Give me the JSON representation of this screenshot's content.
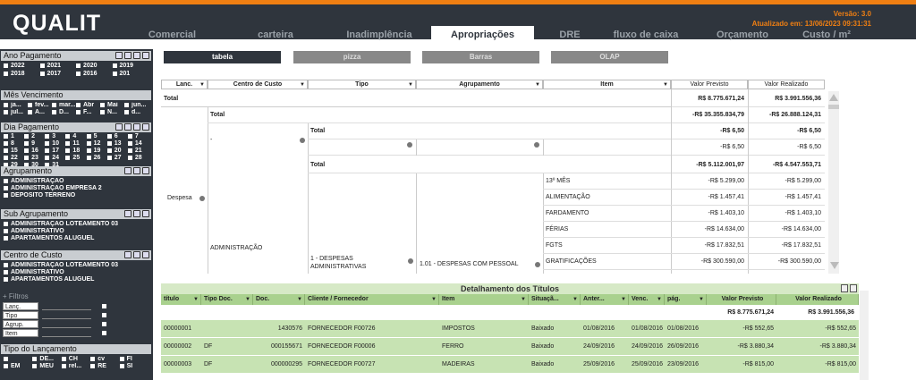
{
  "app": {
    "logo": "QUALIT",
    "version": "Versão: 3.0",
    "updated": "Atualizado em: 13/06/2023 09:31:31"
  },
  "tabs": [
    "Comercial",
    "carteira",
    "Inadimplência",
    "Apropriações",
    "DRE",
    "fluxo de caixa",
    "Orçamento",
    "Custo / m²"
  ],
  "active_tab": "Apropriações",
  "sidebar": {
    "ano": {
      "title": "Ano Pagamento",
      "items": [
        "2022",
        "2021",
        "2020",
        "2019",
        "2018",
        "2017",
        "2016",
        "201"
      ]
    },
    "mes": {
      "title": "Mês Vencimento",
      "items": [
        "ja...",
        "fev...",
        "mar...",
        "Abr",
        "Mai",
        "jun...",
        "jul...",
        "A...",
        "D...",
        "F...",
        "N...",
        "d..."
      ]
    },
    "dia": {
      "title": "Dia Pagamento",
      "items": [
        "1",
        "2",
        "3",
        "4",
        "5",
        "6",
        "7",
        "8",
        "9",
        "10",
        "11",
        "12",
        "13",
        "14",
        "15",
        "16",
        "17",
        "18",
        "19",
        "20",
        "21",
        "22",
        "23",
        "24",
        "25",
        "26",
        "27",
        "28",
        "29",
        "30",
        "31"
      ]
    },
    "agrupamento": {
      "title": "Agrupamento",
      "items": [
        "ADMINISTRAÇÃO",
        "ADMINISTRAÇÃO EMPRESA 2",
        "DEPÓSITO TERRENO"
      ]
    },
    "subagrupamento": {
      "title": "Sub Agrupamento",
      "items": [
        "ADMINISTRAÇÃO LOTEAMENTO 03",
        "ADMINISTRATIVO",
        "APARTAMENTOS ALUGUEL"
      ]
    },
    "centro": {
      "title": "Centro de Custo",
      "items": [
        "ADMINISTRAÇÃO LOTEAMENTO 03",
        "ADMINISTRATIVO",
        "APARTAMENTOS ALUGUEL"
      ]
    },
    "filtros": {
      "title": "+ Filtros",
      "rows": [
        "Lanç.",
        "Tipo",
        "Agrup.",
        "Item"
      ]
    },
    "tipo_lanc": {
      "title": "Tipo do Lançamento",
      "items": [
        "",
        "DE...",
        "CH",
        "cv",
        "FI",
        "EM",
        "MEU",
        "rel...",
        "RE",
        "SI"
      ]
    }
  },
  "views": [
    "tabela",
    "pizza",
    "Barras",
    "OLAP"
  ],
  "main_table": {
    "headers": [
      "Lanc.",
      "Centro de Custo",
      "Tipo",
      "Agrupamento",
      "Item",
      "Valor Previsto",
      "Valor Realizado"
    ],
    "total_label": "Total",
    "total_prev": "R$ 8.775.671,24",
    "total_real": "R$ 3.991.556,36",
    "despesa_label": "Despesa",
    "cc_total_prev": "-R$ 35.355.834,79",
    "cc_total_real": "-R$ 26.888.124,31",
    "dash": "-",
    "dash_total_prev": "-R$ 6,50",
    "dash_total_real": "-R$ 6,50",
    "dash_row_prev": "-R$ 6,50",
    "dash_row_real": "-R$ 6,50",
    "adm_label": "ADMINISTRAÇÃO",
    "adm_total_prev": "-R$ 5.112.001,97",
    "adm_total_real": "-R$ 4.547.553,71",
    "tipo_label": "1 - DESPESAS ADMINISTRATIVAS",
    "agrup_label": "1.01 - DESPESAS COM PESSOAL",
    "items": [
      {
        "name": "13º MÊS",
        "prev": "-R$ 5.299,00",
        "real": "-R$ 5.299,00"
      },
      {
        "name": "ALIMENTAÇÃO",
        "prev": "-R$ 1.457,41",
        "real": "-R$ 1.457,41"
      },
      {
        "name": "FARDAMENTO",
        "prev": "-R$ 1.403,10",
        "real": "-R$ 1.403,10"
      },
      {
        "name": "FÉRIAS",
        "prev": "-R$ 14.634,00",
        "real": "-R$ 14.634,00"
      },
      {
        "name": "FGTS",
        "prev": "-R$ 17.832,51",
        "real": "-R$ 17.832,51"
      },
      {
        "name": "GRATIFICAÇÕES",
        "prev": "-R$ 300.590,00",
        "real": "-R$ 300.590,00"
      }
    ]
  },
  "detail": {
    "title": "Detalhamento dos Títulos",
    "headers": [
      "título",
      "Tipo Doc.",
      "Doc.",
      "Cliente / Fornecedor",
      "Item",
      "Situaçã...",
      "Anter...",
      "Venc.",
      "pág.",
      "Valor Previsto",
      "Valor Realizado"
    ],
    "total_prev": "R$ 8.775.671,24",
    "total_real": "R$ 3.991.556,36",
    "rows": [
      [
        "00000001",
        "",
        "1430576",
        "FORNECEDOR F00726",
        "IMPOSTOS",
        "Baixado",
        "01/08/2016",
        "01/08/2016",
        "01/08/2016",
        "-R$ 552,65",
        "-R$ 552,65"
      ],
      [
        "00000002",
        "DF",
        "000155671",
        "FORNECEDOR F00006",
        "FERRO",
        "Baixado",
        "24/09/2016",
        "24/09/2016",
        "26/09/2016",
        "-R$ 3.880,34",
        "-R$ 3.880,34"
      ],
      [
        "00000003",
        "DF",
        "000000295",
        "FORNECEDOR F00727",
        "MADEIRAS",
        "Baixado",
        "25/09/2016",
        "25/09/2016",
        "23/09/2016",
        "-R$ 815,00",
        "-R$ 815,00"
      ]
    ]
  },
  "colors": {
    "header": "#2f353d",
    "accent": "#f07f12",
    "detail_row": "#c7e3b3",
    "detail_head": "#a9d18e"
  }
}
